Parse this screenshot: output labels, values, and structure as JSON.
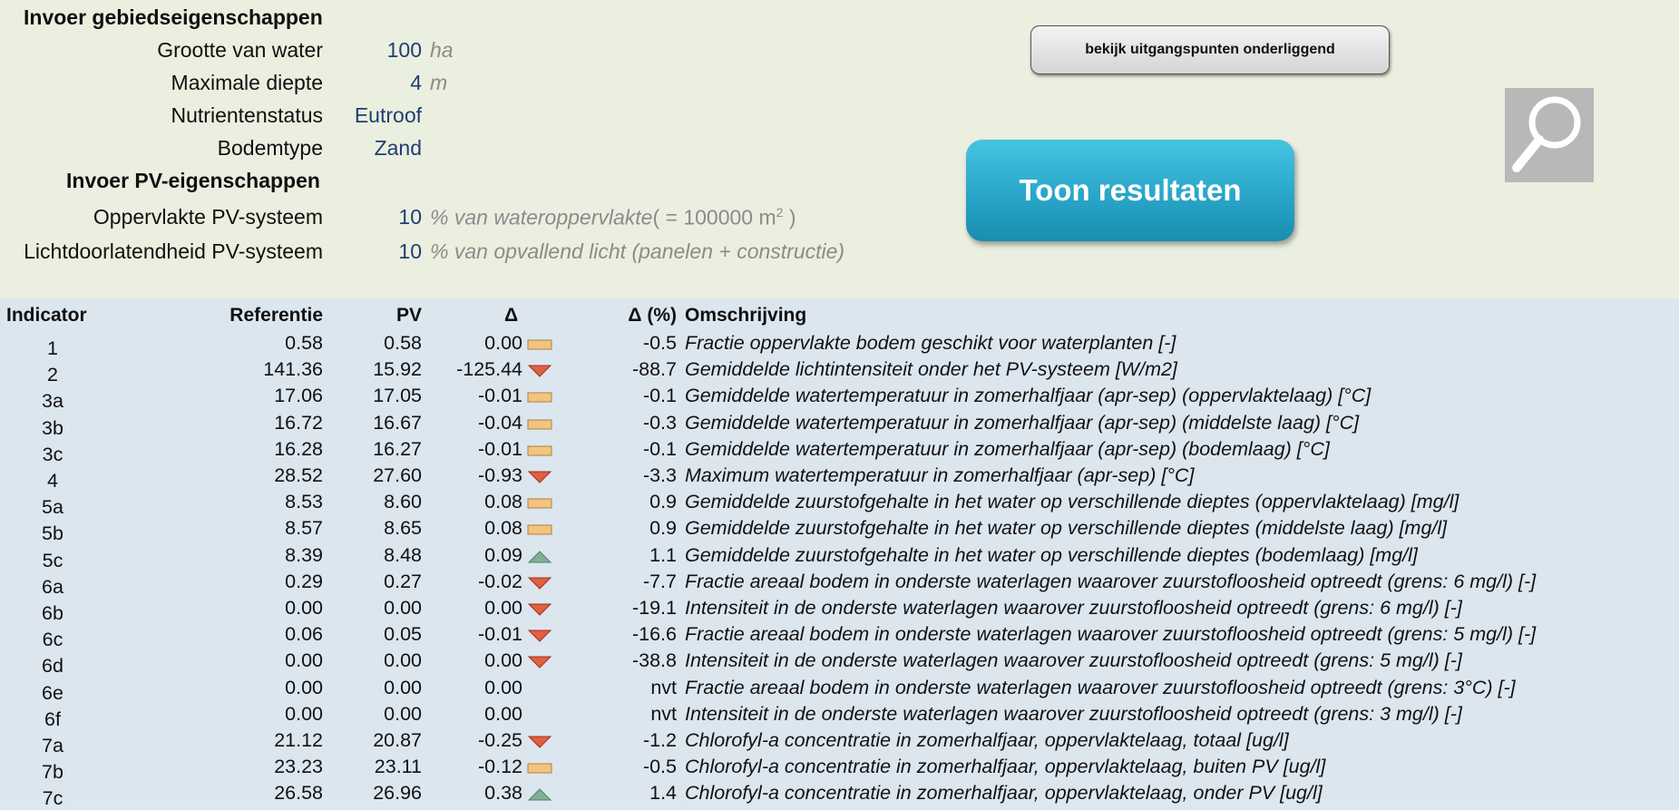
{
  "gebied": {
    "title": "Invoer gebiedseigenschappen",
    "grootte": {
      "label": "Grootte van water",
      "value": "100",
      "unit": "ha"
    },
    "diepte": {
      "label": "Maximale diepte",
      "value": "4",
      "unit": "m"
    },
    "nutrient": {
      "label": "Nutrientenstatus",
      "value": "Eutroof"
    },
    "bodem": {
      "label": "Bodemtype",
      "value": "Zand"
    }
  },
  "pv": {
    "title": "Invoer PV-eigenschappen",
    "oppervlakte": {
      "label": "Oppervlakte PV-systeem",
      "value": "10",
      "unit_pre": "% van wateroppervlakte",
      "unit_mid": "( = 100000  m",
      "unit_sup": "2",
      "unit_post": " )"
    },
    "licht": {
      "label": "Lichtdoorlatendheid PV-systeem",
      "value": "10",
      "unit": "% van opvallend licht (panelen + constructie)"
    }
  },
  "buttons": {
    "uitgangspunten": "bekijk uitgangspunten onderliggend",
    "toon": "Toon resultaten"
  },
  "icons": {
    "search": "magnifier-icon"
  },
  "colors": {
    "up": "#7fb096",
    "down": "#e06040",
    "neutral": "#f2c480",
    "value_blue": "#1f3e74",
    "button_teal": "#29a6c9"
  },
  "table": {
    "headers": {
      "indicator": "Indicator",
      "referentie": "Referentie",
      "pv": "PV",
      "delta": "Δ",
      "delta_pct": "Δ (%)",
      "omschrijving": "Omschrijving"
    },
    "rows": [
      {
        "ind": "1",
        "ref": "0.58",
        "pv": "0.58",
        "delta": "0.00",
        "mark": "neutral",
        "pct": "-0.5",
        "desc": "Fractie oppervlakte bodem geschikt voor waterplanten [-]"
      },
      {
        "ind": "2",
        "ref": "141.36",
        "pv": "15.92",
        "delta": "-125.44",
        "mark": "down",
        "pct": "-88.7",
        "desc": "Gemiddelde lichtintensiteit onder het PV-systeem [W/m2]"
      },
      {
        "ind": "3a",
        "ref": "17.06",
        "pv": "17.05",
        "delta": "-0.01",
        "mark": "neutral",
        "pct": "-0.1",
        "desc": "Gemiddelde watertemperatuur in zomerhalfjaar (apr-sep) (oppervlaktelaag) [°C]"
      },
      {
        "ind": "3b",
        "ref": "16.72",
        "pv": "16.67",
        "delta": "-0.04",
        "mark": "neutral",
        "pct": "-0.3",
        "desc": "Gemiddelde watertemperatuur in zomerhalfjaar (apr-sep) (middelste laag) [°C]"
      },
      {
        "ind": "3c",
        "ref": "16.28",
        "pv": "16.27",
        "delta": "-0.01",
        "mark": "neutral",
        "pct": "-0.1",
        "desc": "Gemiddelde watertemperatuur in zomerhalfjaar (apr-sep) (bodemlaag) [°C]"
      },
      {
        "ind": "4",
        "ref": "28.52",
        "pv": "27.60",
        "delta": "-0.93",
        "mark": "down",
        "pct": "-3.3",
        "desc": "Maximum watertemperatuur in zomerhalfjaar (apr-sep) [°C]"
      },
      {
        "ind": "5a",
        "ref": "8.53",
        "pv": "8.60",
        "delta": "0.08",
        "mark": "neutral",
        "pct": "0.9",
        "desc": "Gemiddelde zuurstofgehalte in het water op verschillende dieptes (oppervlaktelaag) [mg/l]"
      },
      {
        "ind": "5b",
        "ref": "8.57",
        "pv": "8.65",
        "delta": "0.08",
        "mark": "neutral",
        "pct": "0.9",
        "desc": "Gemiddelde zuurstofgehalte in het water op verschillende dieptes (middelste laag) [mg/l]"
      },
      {
        "ind": "5c",
        "ref": "8.39",
        "pv": "8.48",
        "delta": "0.09",
        "mark": "up",
        "pct": "1.1",
        "desc": "Gemiddelde zuurstofgehalte in het water op verschillende dieptes (bodemlaag) [mg/l]"
      },
      {
        "ind": "6a",
        "ref": "0.29",
        "pv": "0.27",
        "delta": "-0.02",
        "mark": "down",
        "pct": "-7.7",
        "desc": "Fractie areaal bodem in onderste waterlagen waarover zuurstofloosheid optreedt (grens: 6 mg/l) [-]"
      },
      {
        "ind": "6b",
        "ref": "0.00",
        "pv": "0.00",
        "delta": "0.00",
        "mark": "down",
        "pct": "-19.1",
        "desc": "Intensiteit in de onderste waterlagen waarover zuurstofloosheid optreedt (grens: 6 mg/l) [-]"
      },
      {
        "ind": "6c",
        "ref": "0.06",
        "pv": "0.05",
        "delta": "-0.01",
        "mark": "down",
        "pct": "-16.6",
        "desc": "Fractie areaal bodem in onderste waterlagen waarover zuurstofloosheid optreedt (grens: 5 mg/l) [-]"
      },
      {
        "ind": "6d",
        "ref": "0.00",
        "pv": "0.00",
        "delta": "0.00",
        "mark": "down",
        "pct": "-38.8",
        "desc": "Intensiteit in de onderste waterlagen waarover zuurstofloosheid optreedt (grens: 5 mg/l) [-]"
      },
      {
        "ind": "6e",
        "ref": "0.00",
        "pv": "0.00",
        "delta": "0.00",
        "mark": "none",
        "pct": "nvt",
        "desc": "Fractie areaal bodem in onderste waterlagen waarover zuurstofloosheid optreedt (grens: 3°C) [-]"
      },
      {
        "ind": "6f",
        "ref": "0.00",
        "pv": "0.00",
        "delta": "0.00",
        "mark": "none",
        "pct": "nvt",
        "desc": "Intensiteit in de onderste waterlagen waarover zuurstofloosheid optreedt (grens: 3 mg/l) [-]"
      },
      {
        "ind": "7a",
        "ref": "21.12",
        "pv": "20.87",
        "delta": "-0.25",
        "mark": "down",
        "pct": "-1.2",
        "desc": "Chlorofyl-a concentratie in zomerhalfjaar, oppervlaktelaag, totaal [ug/l]"
      },
      {
        "ind": "7b",
        "ref": "23.23",
        "pv": "23.11",
        "delta": "-0.12",
        "mark": "neutral",
        "pct": "-0.5",
        "desc": "Chlorofyl-a concentratie in zomerhalfjaar, oppervlaktelaag, buiten PV [ug/l]"
      },
      {
        "ind": "7c",
        "ref": "26.58",
        "pv": "26.96",
        "delta": "0.38",
        "mark": "up",
        "pct": "1.4",
        "desc": "Chlorofyl-a concentratie in zomerhalfjaar, oppervlaktelaag, onder PV [ug/l]"
      }
    ]
  }
}
